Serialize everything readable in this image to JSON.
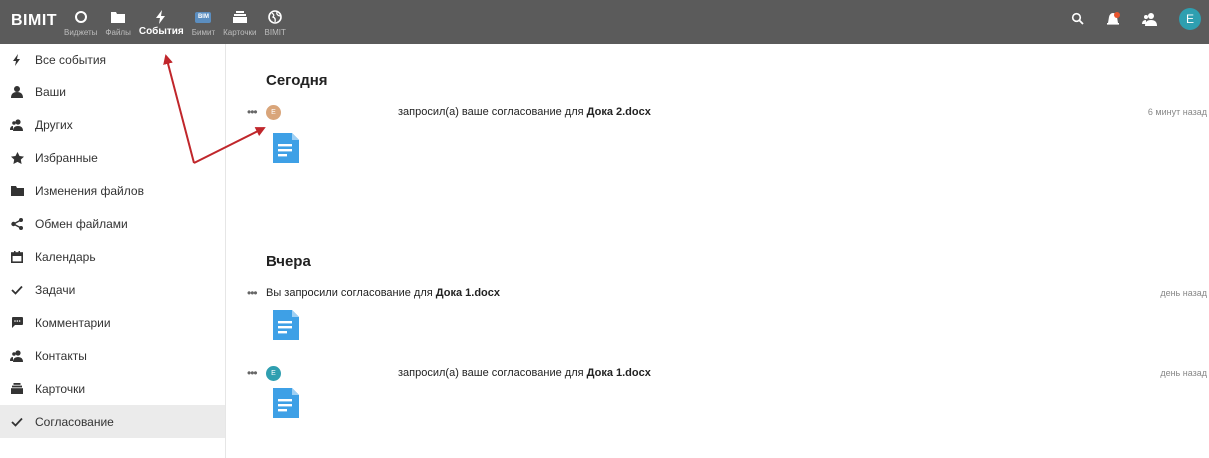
{
  "topbar": {
    "logo": "BIMIT",
    "apps": [
      {
        "label": "Виджеты",
        "icon": "circle-icon"
      },
      {
        "label": "Файлы",
        "icon": "folder-icon"
      },
      {
        "label": "События",
        "icon": "lightning-icon",
        "active": true
      },
      {
        "label": "Бимит",
        "icon": "bim-logo-icon",
        "badge": "BIM"
      },
      {
        "label": "Карточки",
        "icon": "cards-icon"
      },
      {
        "label": "BIMIT",
        "icon": "globe-icon"
      }
    ],
    "user_initial": "E"
  },
  "sidebar": {
    "items": [
      {
        "label": "Все события",
        "icon": "lightning-icon"
      },
      {
        "label": "Ваши",
        "icon": "user-icon"
      },
      {
        "label": "Других",
        "icon": "users-icon"
      },
      {
        "label": "Избранные",
        "icon": "star-icon"
      },
      {
        "label": "Изменения файлов",
        "icon": "folder-icon"
      },
      {
        "label": "Обмен файлами",
        "icon": "share-icon"
      },
      {
        "label": "Календарь",
        "icon": "calendar-icon"
      },
      {
        "label": "Задачи",
        "icon": "check-icon"
      },
      {
        "label": "Комментарии",
        "icon": "comment-icon"
      },
      {
        "label": "Контакты",
        "icon": "contacts-icon"
      },
      {
        "label": "Карточки",
        "icon": "cards-icon"
      },
      {
        "label": "Согласование",
        "icon": "check-icon",
        "active": true
      }
    ]
  },
  "main": {
    "today": {
      "title": "Сегодня",
      "activity": {
        "avatar_initial": "E",
        "avatar_color": "#d9a57a",
        "text_prefix": "запросил(а) ваше согласование для ",
        "file": "Дока 2.docx",
        "time": "6 минут назад"
      }
    },
    "yesterday": {
      "title": "Вчера",
      "activities": [
        {
          "text_prefix": "Вы запросили согласование для ",
          "file": "Дока 1.docx",
          "time": "день назад"
        },
        {
          "avatar_initial": "E",
          "avatar_color": "#2f9fb0",
          "text_prefix": "запросил(а) ваше согласование для ",
          "file": "Дока 1.docx",
          "time": "день назад"
        }
      ]
    }
  },
  "colors": {
    "topbar": "#5b5b5b",
    "doc_icon": "#3ea0e6",
    "arrow": "#c0262b",
    "active_bg": "#ebebeb"
  }
}
